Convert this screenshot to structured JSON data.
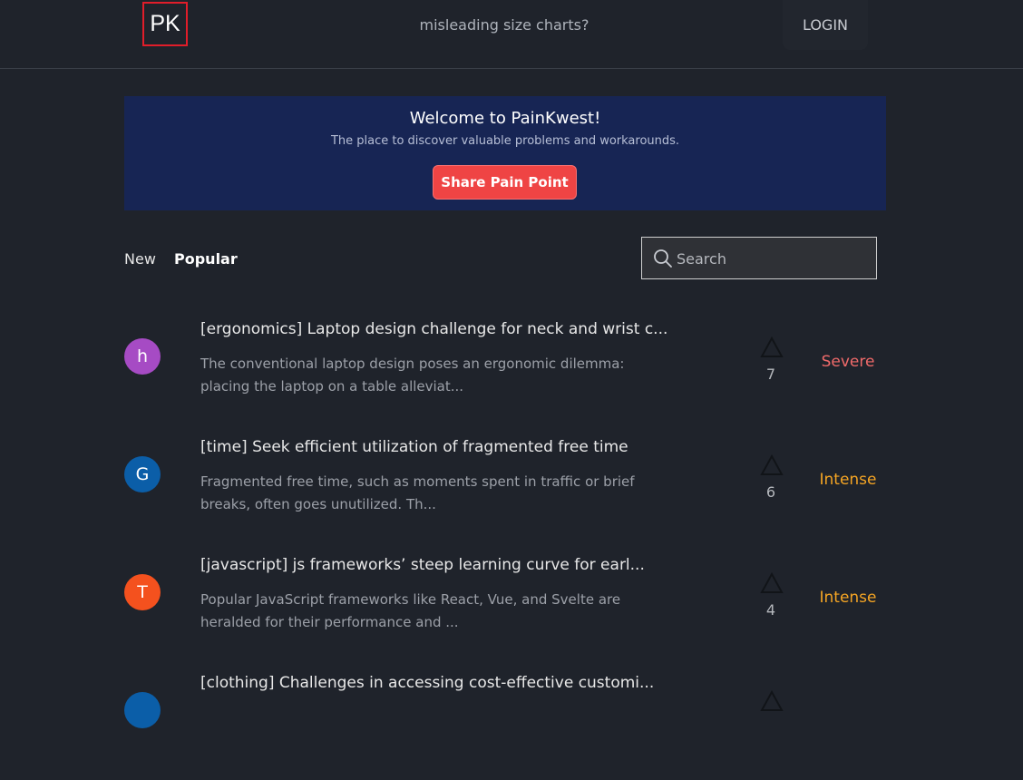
{
  "header": {
    "logo": "PK",
    "tagline": "misleading size charts?",
    "login_label": "LOGIN"
  },
  "banner": {
    "title": "Welcome to PainKwest!",
    "subtitle": "The place to discover valuable problems and workarounds.",
    "cta_label": "Share Pain Point",
    "bg_color": "#172554",
    "cta_color": "#ef4444"
  },
  "tabs": [
    {
      "label": "New",
      "active": false
    },
    {
      "label": "Popular",
      "active": true
    }
  ],
  "search": {
    "placeholder": "Search",
    "value": "",
    "icon": "search-icon"
  },
  "posts": [
    {
      "avatar_letter": "h",
      "avatar_color": "#a64bc4",
      "title": "[ergonomics] Laptop design challenge for neck and wrist c...",
      "description": "The conventional laptop design poses an ergonomic dilemma: placing the laptop on a table alleviat...",
      "votes": "7",
      "severity": "Severe",
      "severity_color": "#f06a6a"
    },
    {
      "avatar_letter": "G",
      "avatar_color": "#0b5ea8",
      "title": "[time] Seek efficient utilization of fragmented free time",
      "description": "Fragmented free time, such as moments spent in traffic or brief breaks, often goes unutilized. Th...",
      "votes": "6",
      "severity": "Intense",
      "severity_color": "#f5a524"
    },
    {
      "avatar_letter": "T",
      "avatar_color": "#f4511e",
      "title": "[javascript] js frameworks’ steep learning curve for earl...",
      "description": "Popular JavaScript frameworks like React, Vue, and Svelte are heralded for their performance and ...",
      "votes": "4",
      "severity": "Intense",
      "severity_color": "#f5a524"
    },
    {
      "avatar_letter": "",
      "avatar_color": "#0b5ea8",
      "title": "[clothing] Challenges in accessing cost-effective customi...",
      "description": "",
      "votes": "",
      "severity": "",
      "severity_color": "#f5a524"
    }
  ]
}
